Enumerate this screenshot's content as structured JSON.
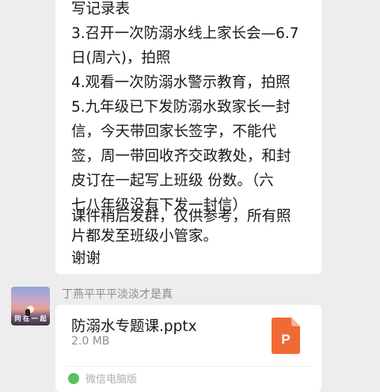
{
  "message": {
    "lines": [
      "写记录表",
      "3.召开一次防溺水线上家长会—6.7",
      "日(周六)，拍照",
      "4.观看一次防溺水警示教育，拍照",
      "5.九年级已下发防溺水致家长一封",
      "信，今天带回家长签字，不能代",
      "签，周一带回收齐交政教处，和封",
      "皮订在一起写上班级  份数。（六",
      "七八年级没有下发一封信）",
      "",
      "课件稍后发群，仅供参考，所有照",
      "片都发至班级小管家。",
      "谢谢"
    ]
  },
  "sender": {
    "name": "丁燕平平平淡淡才是真",
    "avatar_caption": "同 在 一 起"
  },
  "file": {
    "name": "防溺水专题课.pptx",
    "size": "2.0 MB",
    "icon_letter": "P",
    "icon_color": "#f06a35",
    "source": "微信电脑版"
  }
}
